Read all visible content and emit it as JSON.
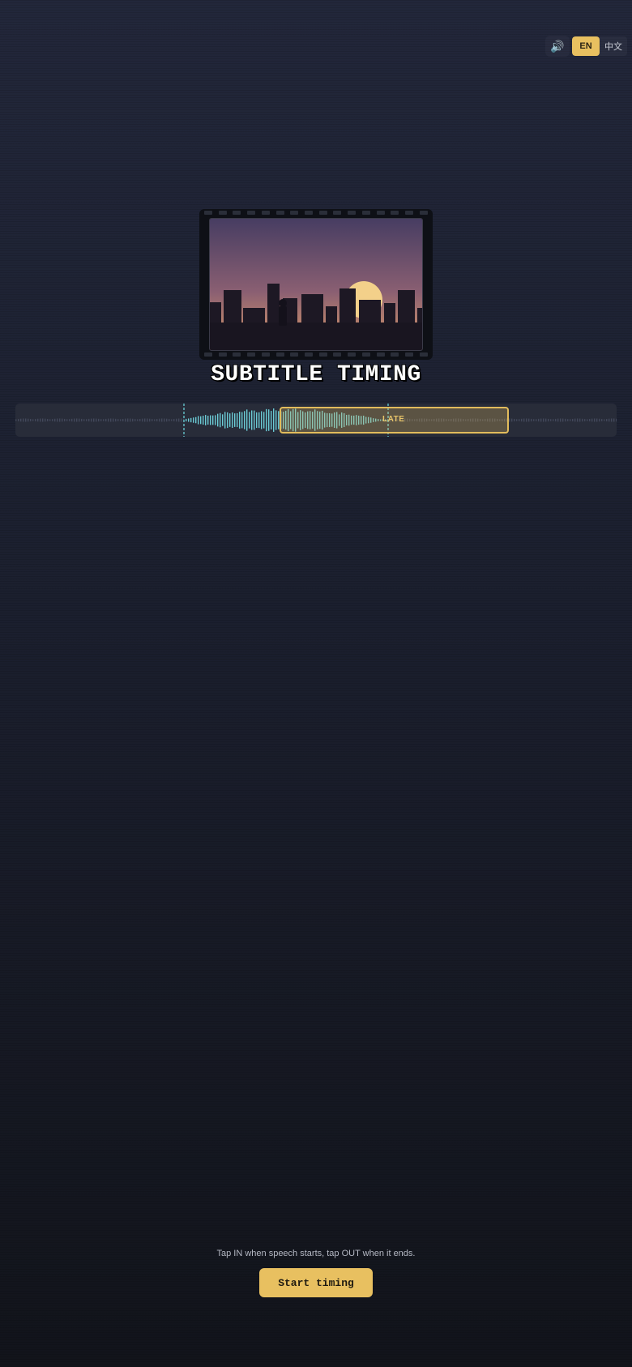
{
  "controls": {
    "sound_icon": "speaker-icon",
    "sound_glyph": "🔊",
    "lang_en": "EN",
    "lang_zh": "中文",
    "active_lang": "EN"
  },
  "title": "SUBTITLE TIMING",
  "timeline": {
    "late_label": "LATE",
    "colors": {
      "waveform_active": "#6fd3dc",
      "waveform_idle": "#4a5064",
      "marker": "#5fb7c0",
      "late_border": "#e2bc5c",
      "late_fill": "#e2bc5c"
    }
  },
  "footer": {
    "hint": "Tap IN when speech starts, tap OUT when it ends.",
    "start_label": "Start timing"
  },
  "colors": {
    "accent": "#e8c060",
    "sun": "#f3d08a",
    "sky_top": "#4a3f63",
    "sky_horizon": "#b57a6a",
    "silhouette": "#1d1824"
  }
}
